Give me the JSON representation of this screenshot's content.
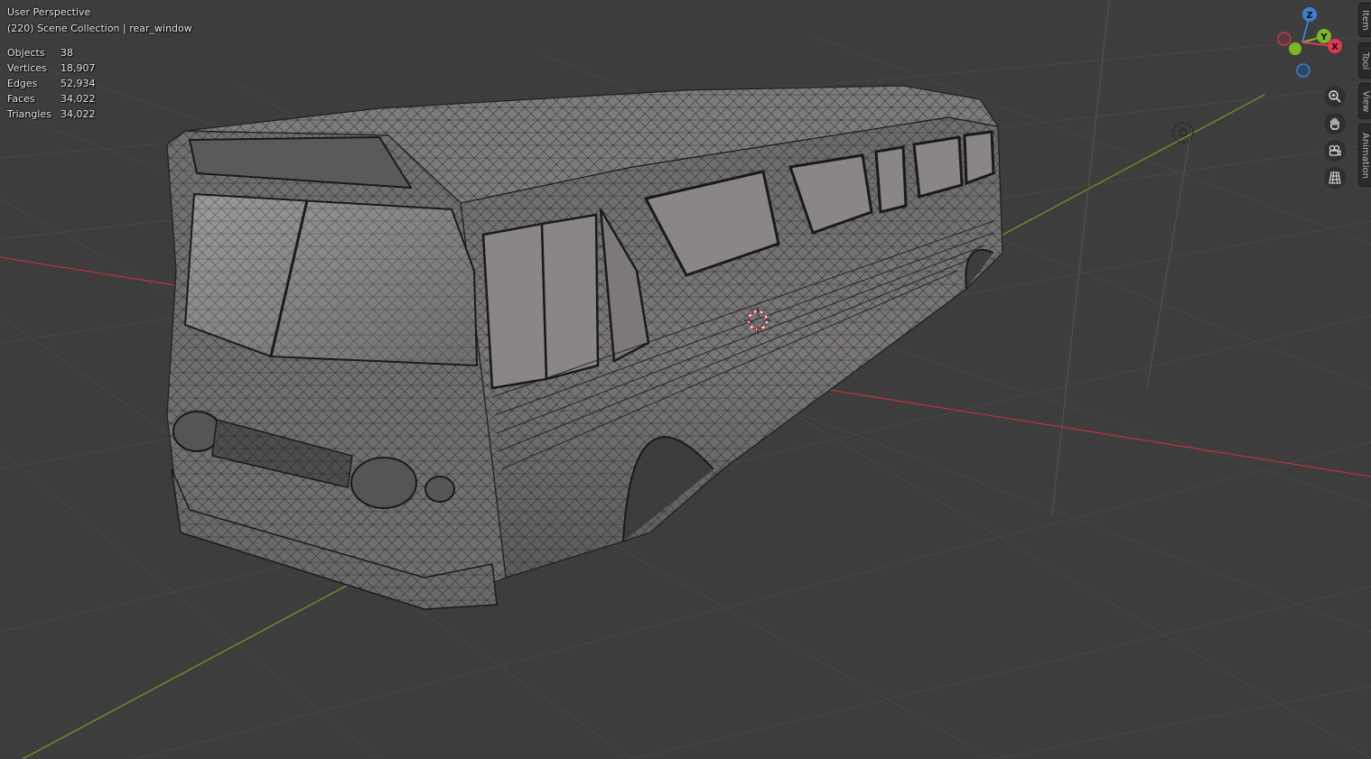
{
  "viewport": {
    "view_name": "User Perspective",
    "collection_line": "(220) Scene Collection | rear_window",
    "background": "#3d3d3d"
  },
  "stats": [
    {
      "label": "Objects",
      "value": "38"
    },
    {
      "label": "Vertices",
      "value": "18,907"
    },
    {
      "label": "Edges",
      "value": "52,934"
    },
    {
      "label": "Faces",
      "value": "34,022"
    },
    {
      "label": "Triangles",
      "value": "34,022"
    }
  ],
  "gizmo": {
    "z_label": "Z",
    "y_label": "Y",
    "x_label": "X",
    "colors": {
      "x": "#e0394f",
      "y": "#7cb729",
      "z": "#3e80cf"
    }
  },
  "nav_buttons": [
    {
      "name": "zoom-icon"
    },
    {
      "name": "hand-pan-icon"
    },
    {
      "name": "camera-view-icon"
    },
    {
      "name": "ortho-grid-icon"
    }
  ],
  "side_tabs": [
    {
      "label": "Item"
    },
    {
      "label": "Tool"
    },
    {
      "label": "View"
    },
    {
      "label": "Animation"
    }
  ],
  "axis_colors": {
    "x_axis": "#b8323f",
    "y_axis": "#6a9a2a"
  }
}
